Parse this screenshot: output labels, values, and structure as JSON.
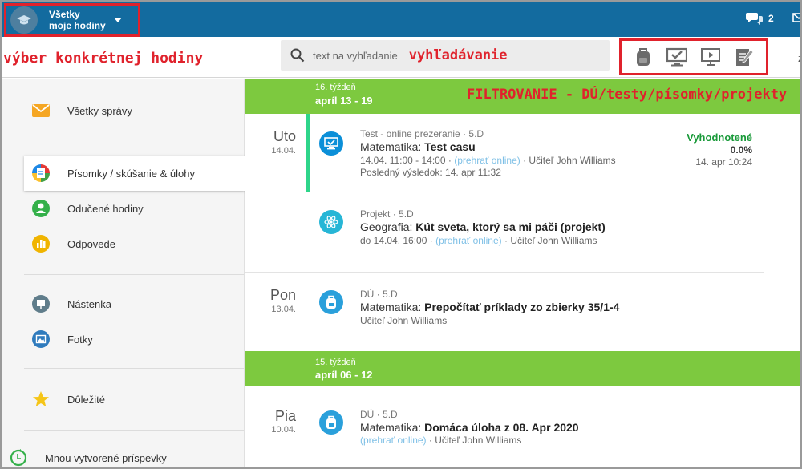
{
  "topbar": {
    "class_selector_line1": "Všetky",
    "class_selector_line2": "moje hodiny",
    "message_count": "2"
  },
  "annotations": {
    "class_selection": "výber konkrétnej hodiny",
    "search": "vyhľadávanie",
    "filtering": "FILTROVANIE -  DÚ/testy/písomky/projekty"
  },
  "search": {
    "placeholder": "text na vyhľadanie"
  },
  "subbar": {
    "cut_letter": "z"
  },
  "sidebar": {
    "items": [
      {
        "label": "Všetky správy",
        "icon": "envelope-icon",
        "color": "#f5a623"
      },
      {
        "label": "Písomky / skúšanie & úlohy",
        "icon": "assignments-icon",
        "color": "#3f6ad8"
      },
      {
        "label": "Odučené hodiny",
        "icon": "person-icon",
        "color": "#34b04a"
      },
      {
        "label": "Odpovede",
        "icon": "bar-chart-icon",
        "color": "#f0b400"
      },
      {
        "label": "Nástenka",
        "icon": "board-icon",
        "color": "#607d8b"
      },
      {
        "label": "Fotky",
        "icon": "photo-icon",
        "color": "#2f7bbd"
      },
      {
        "label": "Dôležité",
        "icon": "star-icon",
        "color": "#f5c518"
      },
      {
        "label": "Mnou vytvorené príspevky",
        "icon": "refresh-icon",
        "color": "#34b04a"
      }
    ]
  },
  "weeks": [
    {
      "label": "16. týždeň",
      "dates": "apríl 13 - 19",
      "days": [
        {
          "name": "Uto",
          "date": "14.04.",
          "entries": [
            {
              "type": "Test - online prezeranie",
              "class": "5.D",
              "subject": "Matematika:",
              "title": "Test casu",
              "meta_time": "14.04. 11:00 - 14:00",
              "meta_link": "(prehrať online)",
              "meta_teacher": "Učiteľ John Williams",
              "meta_extra": "Posledný výsledok: 14. apr 11:32",
              "status": "Vyhodnotené",
              "score": "0.0%",
              "status_date": "14. apr 10:24"
            },
            {
              "type": "Projekt",
              "class": "5.D",
              "subject": "Geografia:",
              "title": "Kút sveta, ktorý sa mi páči (projekt)",
              "meta_time": "do 14.04. 16:00",
              "meta_link": "(prehrať online)",
              "meta_teacher": "Učiteľ John Williams"
            }
          ]
        },
        {
          "name": "Pon",
          "date": "13.04.",
          "entries": [
            {
              "type": "DÚ",
              "class": "5.D",
              "subject": "Matematika:",
              "title": "Prepočítať príklady zo zbierky 35/1-4",
              "meta_teacher": "Učiteľ John Williams"
            }
          ]
        }
      ]
    },
    {
      "label": "15. týždeň",
      "dates": "apríl 06 - 12",
      "days": [
        {
          "name": "Pia",
          "date": "10.04.",
          "entries": [
            {
              "type": "DÚ",
              "class": "5.D",
              "subject": "Matematika:",
              "title": "Domáca úloha z 08. Apr 2020",
              "meta_link": "(prehrať online)",
              "meta_teacher": "Učiteľ John Williams"
            }
          ]
        }
      ]
    }
  ],
  "colors": {
    "topbar": "#136b9f",
    "week_band": "#7dc93f",
    "annotation_red": "#e0222c",
    "status_green": "#1a9a3a",
    "icon_blue": "#2aa0db",
    "test_icon_blue": "#0b8fd8",
    "project_icon_cyan": "#27b6d6"
  }
}
